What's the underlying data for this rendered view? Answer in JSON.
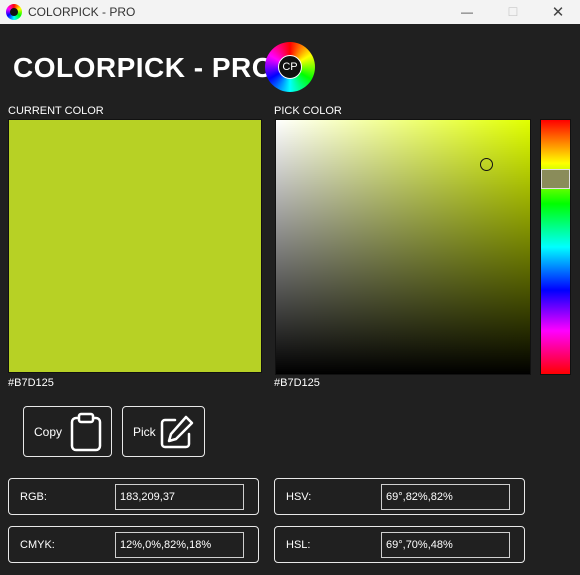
{
  "window": {
    "title": "COLORPICK - PRO",
    "minimize_glyph": "—",
    "maximize_glyph": "☐",
    "close_glyph": "✕"
  },
  "header": {
    "title": "COLORPICK - PRO",
    "logo_text": "CP"
  },
  "current": {
    "label": "CURRENT COLOR",
    "hex": "#B7D125",
    "color": "#B7D125"
  },
  "picker": {
    "label": "PICK COLOR",
    "hex": "#B7D125",
    "hue_color": "#e1ff00"
  },
  "actions": {
    "copy_label": "Copy",
    "copy_icon": "clipboard-icon",
    "pick_label": "Pick",
    "pick_icon": "edit-icon"
  },
  "values": {
    "rgb_label": "RGB:",
    "rgb_value": "183,209,37",
    "hsv_label": "HSV:",
    "hsv_value": "69°,82%,82%",
    "cmyk_label": "CMYK:",
    "cmyk_value": "12%,0%,82%,18%",
    "hsl_label": "HSL:",
    "hsl_value": "69°,70%,48%"
  }
}
